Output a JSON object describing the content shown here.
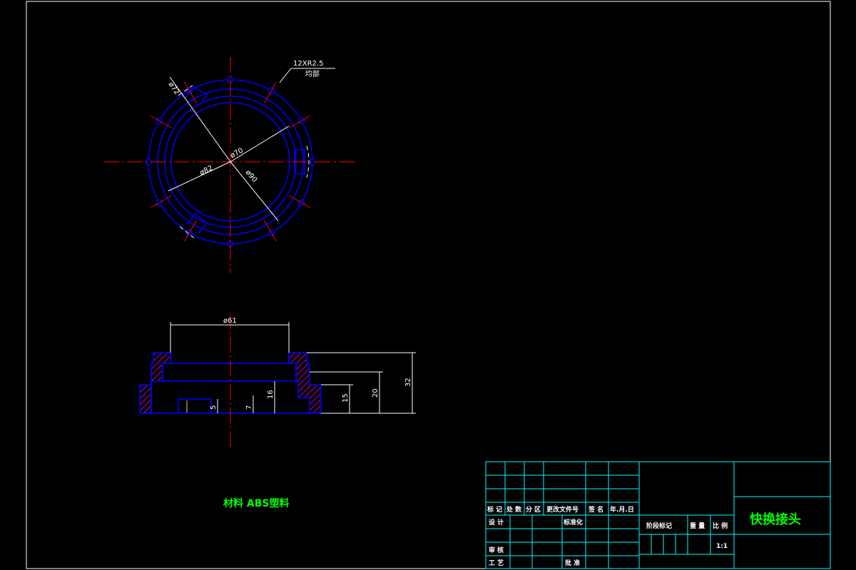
{
  "drawing": {
    "top_view": {
      "note_count_radius": "12XR2.5",
      "note_distribution": "均部",
      "dia_72": "ø72",
      "dia_70": "ø70",
      "dia_82": "ø82",
      "dia_90": "ø90"
    },
    "section_view": {
      "dia_61": "ø61",
      "h_5": "5",
      "h_7": "7",
      "h_16": "16",
      "h_15": "15",
      "h_20": "20",
      "h_32": "32"
    },
    "material_note": "材料 ABS塑料"
  },
  "title_block": {
    "hdr_mark": "标 记",
    "hdr_count": "处 数",
    "hdr_zone": "分 区",
    "hdr_doc": "更改文件号",
    "hdr_sign": "签 名",
    "hdr_date": "年.月.日",
    "design": "设 计",
    "standardize": "标准化",
    "review": "审 核",
    "process": "工 艺",
    "approve": "批 准",
    "stage_mark": "阶段标记",
    "weight": "重 量",
    "scale_label": "比 例",
    "scale_value": "1:1",
    "part_name": "快换接头"
  },
  "colors": {
    "frame": "#ffffff",
    "outline": "#0000ff",
    "center": "#ff0000",
    "dimension": "#ffffff",
    "hatch": "#ff00ff",
    "title_block": "#00ffff",
    "title_text": "#00ff00"
  }
}
